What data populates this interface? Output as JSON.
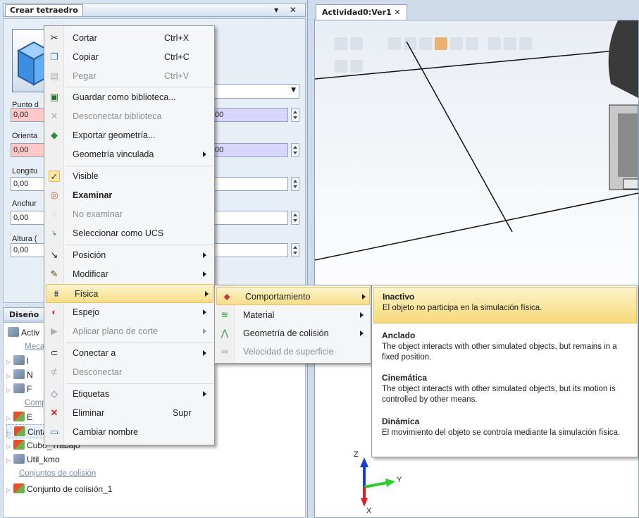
{
  "left_panel": {
    "title": "Crear tetraedro",
    "header_buttons": "▾ ✕",
    "fields": {
      "punto_label": "Punto d",
      "punto_x": "0,00",
      "punto_z": "00",
      "orienta_label": "Orienta",
      "orienta_x": "0,00",
      "orienta_z": "00",
      "longitud_label": "Longitu",
      "longitud_value": "0,00",
      "anchura_label": "Anchur",
      "anchura_value": "0,00",
      "altura_label": "Altura (",
      "altura_value": "0,00"
    },
    "tree_title": "Diseño",
    "tree_rows": [
      "Activ",
      "Meca",
      "l",
      "N",
      "F",
      "Comp",
      "E",
      "Cinta",
      "Cubo_Trabajo",
      "Util_kmo",
      "Conjuntos de colisión",
      "Conjunto de colisión_1"
    ]
  },
  "viewport": {
    "tab_label": "Actividad0:Ver1 ✕",
    "axis_z": "Z",
    "axis_y": "Y",
    "axis_x": "X"
  },
  "context_menu": {
    "items": [
      {
        "label": "Cortar",
        "shortcut": "Ctrl+X",
        "icon": "scissors-icon"
      },
      {
        "label": "Copiar",
        "shortcut": "Ctrl+C",
        "icon": "copy-icon"
      },
      {
        "label": "Pegar",
        "shortcut": "Ctrl+V",
        "icon": "paste-icon"
      },
      {
        "label": "Guardar como biblioteca...",
        "icon": "save-library-icon"
      },
      {
        "label": "Desconectar biblioteca",
        "icon": "disconnect-library-icon"
      },
      {
        "label": "Exportar geometría...",
        "icon": "export-icon"
      },
      {
        "label": "Geometría vinculada"
      },
      {
        "label": "Visible",
        "icon": "check-icon"
      },
      {
        "label": "Examinar",
        "icon": "examine-icon"
      },
      {
        "label": "No examinar",
        "icon": "no-examine-icon"
      },
      {
        "label": "Seleccionar como UCS",
        "icon": "ucs-icon"
      },
      {
        "label": "Posición",
        "icon": "position-icon"
      },
      {
        "label": "Modificar",
        "icon": "pencil-icon"
      },
      {
        "label": "Física",
        "icon": "physics-icon"
      },
      {
        "label": "Espejo",
        "icon": "mirror-icon"
      },
      {
        "label": "Aplicar plano de corte",
        "icon": "cut-plane-icon"
      },
      {
        "label": "Conectar a",
        "icon": "paperclip-icon"
      },
      {
        "label": "Desconectar",
        "icon": "unclip-icon"
      },
      {
        "label": "Etiquetas",
        "icon": "tag-icon"
      },
      {
        "label": "Eliminar",
        "shortcut": "Supr",
        "icon": "delete-icon"
      },
      {
        "label": "Cambiar nombre",
        "icon": "rename-icon"
      }
    ]
  },
  "submenu": {
    "items": [
      {
        "label": "Comportamiento",
        "icon": "behavior-icon"
      },
      {
        "label": "Material",
        "icon": "material-icon"
      },
      {
        "label": "Geometría de colisión",
        "icon": "collision-icon"
      },
      {
        "label": "Velocidad de superficie",
        "icon": "surface-speed-icon"
      }
    ]
  },
  "behavior": {
    "options": [
      {
        "title": "Inactivo",
        "desc": "El objeto no participa en la simulación física."
      },
      {
        "title": "Anclado",
        "desc": "The object interacts with other simulated objects, but remains in a fixed position."
      },
      {
        "title": "Cinemática",
        "desc": "The object interacts with other simulated objects, but its motion is controlled by other means."
      },
      {
        "title": "Dinámica",
        "desc": "El movimiento del objeto se controla mediante la simulación física."
      }
    ]
  },
  "colors": {
    "highlight": "#f7dd88",
    "red_field": "#ffc9c9",
    "purple_field": "#d8d6fa"
  }
}
